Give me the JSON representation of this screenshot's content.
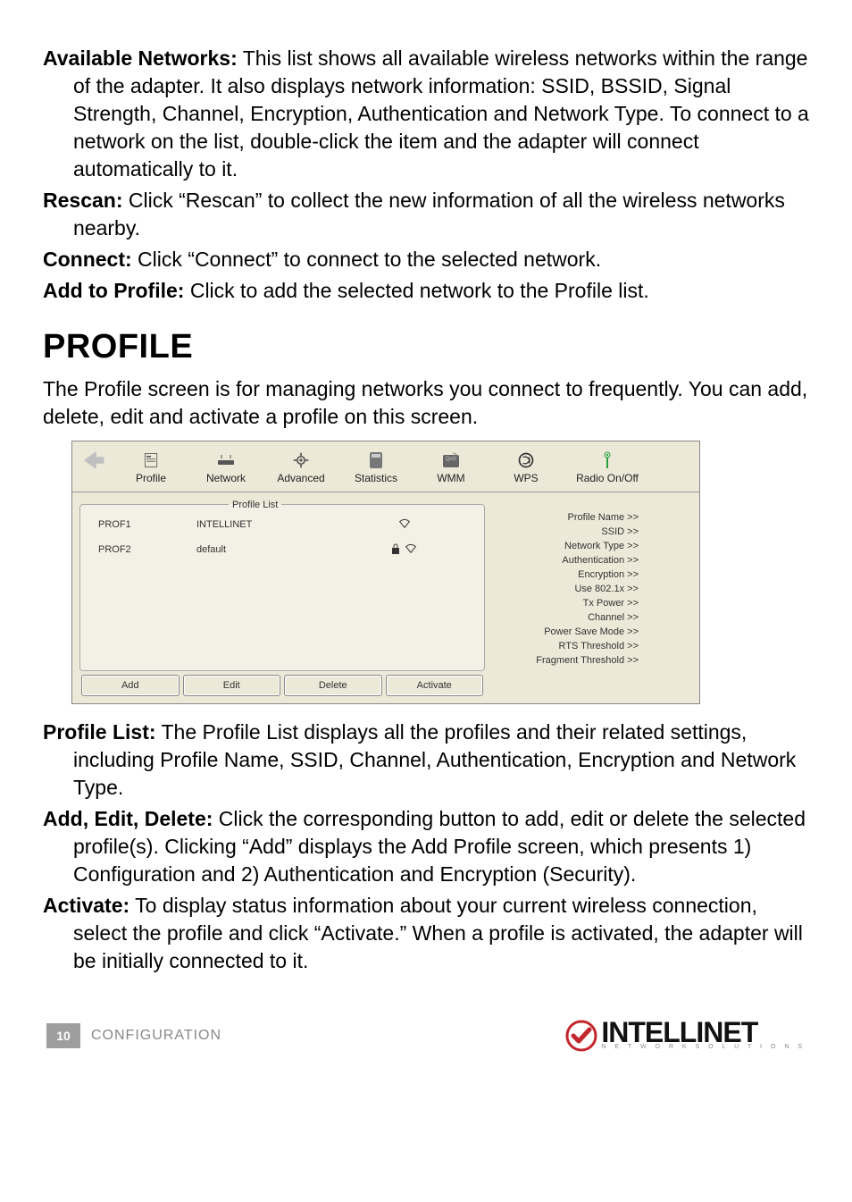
{
  "definitions": [
    {
      "label": "Available Networks:",
      "text": " This list shows all available wireless networks within the range of the adapter. It also displays network information: SSID, BSSID, Signal Strength, Channel, Encryption, Authentication and Network Type. To connect to a network on the list, double-click the item and the adapter will connect automatically to it."
    },
    {
      "label": "Rescan:",
      "text": " Click “Rescan” to collect the new information of all the wireless networks nearby."
    },
    {
      "label": "Connect:",
      "text": " Click “Connect” to connect to the selected network."
    },
    {
      "label": "Add to Profile:",
      "text": " Click to add the selected network to the Profile list."
    }
  ],
  "section_title": "PROFILE",
  "intro": "The Profile screen is for managing networks you connect to frequently. You can add, delete, edit and activate a profile on this screen.",
  "app": {
    "nav": [
      {
        "label": "Profile",
        "icon": "profile-icon"
      },
      {
        "label": "Network",
        "icon": "network-icon"
      },
      {
        "label": "Advanced",
        "icon": "advanced-icon"
      },
      {
        "label": "Statistics",
        "icon": "statistics-icon"
      },
      {
        "label": "WMM",
        "icon": "wmm-icon"
      },
      {
        "label": "WPS",
        "icon": "wps-icon"
      },
      {
        "label": "Radio On/Off",
        "icon": "radio-icon"
      }
    ],
    "profile_list_legend": "Profile List",
    "profiles": [
      {
        "name": "PROF1",
        "ssid": "INTELLINET",
        "locked": false
      },
      {
        "name": "PROF2",
        "ssid": "default",
        "locked": true
      }
    ],
    "buttons": [
      "Add",
      "Edit",
      "Delete",
      "Activate"
    ],
    "info_labels": [
      "Profile Name >>",
      "SSID >>",
      "Network Type >>",
      "Authentication >>",
      "Encryption >>",
      "Use 802.1x >>",
      "Tx Power >>",
      "Channel >>",
      "Power Save Mode >>",
      "RTS Threshold >>",
      "Fragment Threshold >>"
    ]
  },
  "definitions2": [
    {
      "label": "Profile List:",
      "text": " The Profile List displays all the profiles and their related settings, including Profile Name, SSID, Channel, Authentication, Encryption and Network Type."
    },
    {
      "label": "Add, Edit, Delete:",
      "text": " Click the corresponding button to add, edit or delete the selected profile(s). Clicking “Add” displays the Add Profile screen, which presents 1) Configuration and 2) Authentication and Encryption (Security)."
    },
    {
      "label": "Activate:",
      "text": " To display status information about your current wireless connection, select the profile and click “Activate.” When a profile is activated, the adapter will be initially connected to it."
    }
  ],
  "footer": {
    "page_number": "10",
    "section": "CONFIGURATION",
    "brand": "INTELLINET",
    "brand_sub": "N E T W O R K   S O L U T I O N S"
  }
}
